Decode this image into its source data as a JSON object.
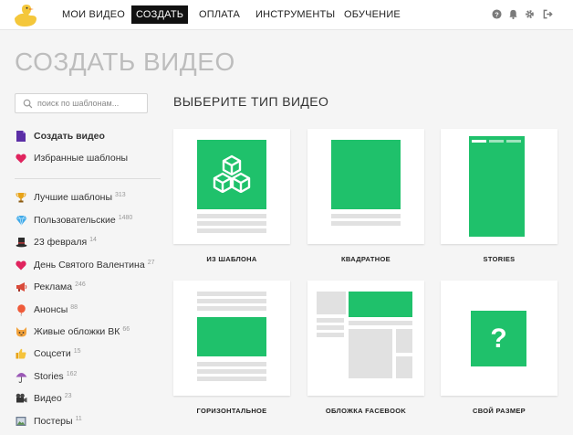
{
  "nav": {
    "items": [
      {
        "label": "МОИ ВИДЕО"
      },
      {
        "label": "СОЗДАТЬ",
        "active": true
      },
      {
        "label": "ОПЛАТА"
      },
      {
        "label": "ИНСТРУМЕНТЫ"
      },
      {
        "label": "ОБУЧЕНИЕ"
      }
    ],
    "icons": [
      "help-icon",
      "bell-icon",
      "settings-gear-icon",
      "logout-icon"
    ]
  },
  "page": {
    "title": "СОЗДАТЬ ВИДЕО"
  },
  "sidebar": {
    "search_placeholder": "поиск по шаблонам...",
    "primary": [
      {
        "label": "Создать видео",
        "icon": "document-icon"
      },
      {
        "label": "Избранные шаблоны",
        "icon": "heart-icon"
      }
    ],
    "categories": [
      {
        "label": "Лучшие шаблоны",
        "count": "313",
        "icon": "trophy-icon"
      },
      {
        "label": "Пользовательские",
        "count": "1480",
        "icon": "gem-icon"
      },
      {
        "label": "23 февраля",
        "count": "14",
        "icon": "top-hat-icon"
      },
      {
        "label": "День Святого Валентина",
        "count": "27",
        "icon": "heart-icon"
      },
      {
        "label": "Реклама",
        "count": "246",
        "icon": "megaphone-icon"
      },
      {
        "label": "Анонсы",
        "count": "88",
        "icon": "balloon-icon"
      },
      {
        "label": "Живые обложки ВК",
        "count": "66",
        "icon": "cat-face-icon"
      },
      {
        "label": "Соцсети",
        "count": "15",
        "icon": "thumbs-up-icon"
      },
      {
        "label": "Stories",
        "count": "162",
        "icon": "umbrella-icon"
      },
      {
        "label": "Видео",
        "count": "23",
        "icon": "movie-camera-icon"
      },
      {
        "label": "Постеры",
        "count": "11",
        "icon": "poster-icon"
      }
    ]
  },
  "main": {
    "section_title": "ВЫБЕРИТЕ ТИП ВИДЕО",
    "cards": [
      {
        "label": "ИЗ ШАБЛОНА",
        "icon": "cubes-icon"
      },
      {
        "label": "КВАДРАТНОЕ"
      },
      {
        "label": "STORIES"
      },
      {
        "label": "ГОРИЗОНТАЛЬНОЕ"
      },
      {
        "label": "ОБЛОЖКА FACEBOOK"
      },
      {
        "label": "СВОЙ РАЗМЕР",
        "glyph": "?"
      }
    ]
  },
  "colors": {
    "accent_green": "#1fc16b",
    "placeholder_gray": "#e1e1e1",
    "nav_active_bg": "#111111",
    "title_gray": "#bdbdbd"
  }
}
